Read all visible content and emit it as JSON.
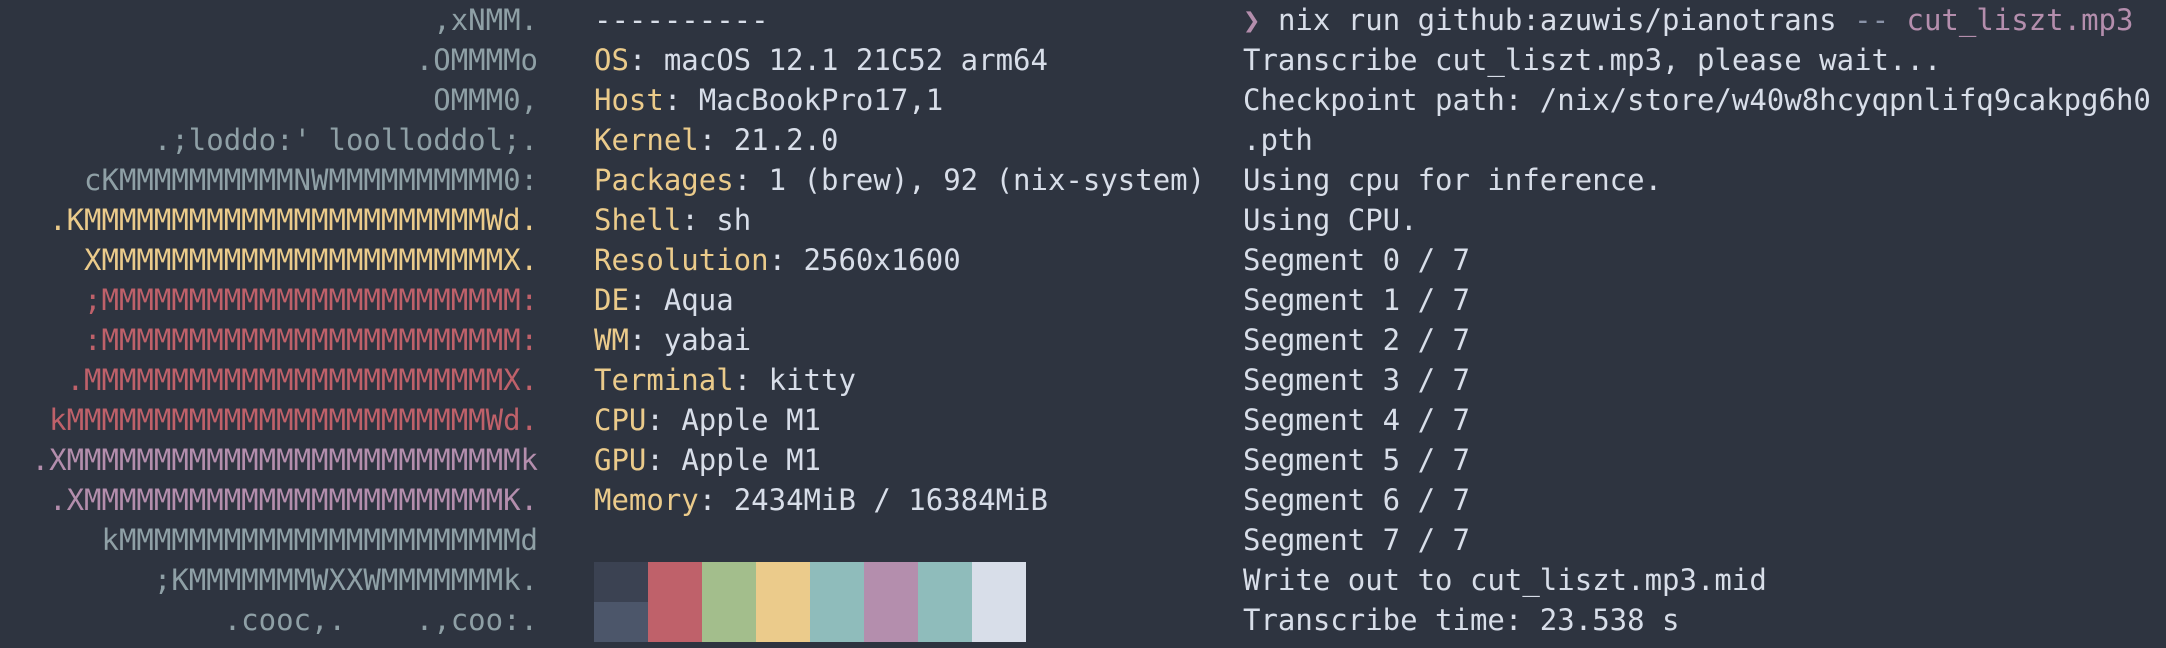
{
  "logo": {
    "lines": [
      {
        "text": ",xNMM.",
        "color": "#8fa0a6"
      },
      {
        "text": ".OMMMMo",
        "color": "#8fa0a6"
      },
      {
        "text": "OMMM0,",
        "color": "#8fa0a6"
      },
      {
        "text": ".;loddo:' loolloddol;.",
        "color": "#8fa0a6"
      },
      {
        "text": "cKMMMMMMMMMMNWMMMMMMMMMM0:",
        "color": "#8fa0a6"
      },
      {
        "text": ".KMMMMMMMMMMMMMMMMMMMMMMMWd.",
        "color": "#ebcb8b"
      },
      {
        "text": "XMMMMMMMMMMMMMMMMMMMMMMMX.",
        "color": "#ebcb8b"
      },
      {
        "text": ";MMMMMMMMMMMMMMMMMMMMMMMM:",
        "color": "#bf616a"
      },
      {
        "text": ":MMMMMMMMMMMMMMMMMMMMMMMM:",
        "color": "#bf616a"
      },
      {
        "text": ".MMMMMMMMMMMMMMMMMMMMMMMMX.",
        "color": "#bf616a"
      },
      {
        "text": "kMMMMMMMMMMMMMMMMMMMMMMMMWd.",
        "color": "#bf616a"
      },
      {
        "text": ".XMMMMMMMMMMMMMMMMMMMMMMMMMMk",
        "color": "#b48ead"
      },
      {
        "text": ".XMMMMMMMMMMMMMMMMMMMMMMMMK.",
        "color": "#b48ead"
      },
      {
        "text": "kMMMMMMMMMMMMMMMMMMMMMMMd",
        "color": "#8fa0a6"
      },
      {
        "text": ";KMMMMMMMWXXWMMMMMMMk.",
        "color": "#8fa0a6"
      },
      {
        "text": ".cooc,.    .,coo:.",
        "color": "#8fa0a6"
      }
    ]
  },
  "info": {
    "separator": "----------",
    "fields": [
      {
        "key": "OS",
        "value": "macOS 12.1 21C52 arm64"
      },
      {
        "key": "Host",
        "value": "MacBookPro17,1"
      },
      {
        "key": "Kernel",
        "value": "21.2.0"
      },
      {
        "key": "Packages",
        "value": "1 (brew), 92 (nix-system)"
      },
      {
        "key": "Shell",
        "value": "sh"
      },
      {
        "key": "Resolution",
        "value": "2560x1600"
      },
      {
        "key": "DE",
        "value": "Aqua"
      },
      {
        "key": "WM",
        "value": "yabai"
      },
      {
        "key": "Terminal",
        "value": "kitty"
      },
      {
        "key": "CPU",
        "value": "Apple M1"
      },
      {
        "key": "GPU",
        "value": "Apple M1"
      },
      {
        "key": "Memory",
        "value": "2434MiB / 16384MiB"
      }
    ],
    "palette": [
      {
        "top": "#3b4252",
        "bottom": "#4c566a"
      },
      {
        "top": "#bf616a",
        "bottom": "#bf616a"
      },
      {
        "top": "#a3be8c",
        "bottom": "#a3be8c"
      },
      {
        "top": "#ebcb8b",
        "bottom": "#ebcb8b"
      },
      {
        "top": "#8fbcbb",
        "bottom": "#8fbcbb"
      },
      {
        "top": "#b48ead",
        "bottom": "#b48ead"
      },
      {
        "top": "#8fbcbb",
        "bottom": "#8fbcbb"
      },
      {
        "top": "#d8dee9",
        "bottom": "#d8dee9"
      }
    ]
  },
  "terminal": {
    "prompt_symbol": "❯",
    "command_program": "nix run github:azuwis/pianotrans ",
    "command_flag": "--",
    "command_arg": " cut_liszt.mp3",
    "output_lines": [
      "Transcribe cut_liszt.mp3, please wait...",
      "Checkpoint path: /nix/store/w40w8hcyqpnlifq9cakpg6h0",
      ".pth",
      "Using cpu for inference.",
      "Using CPU.",
      "Segment 0 / 7",
      "Segment 1 / 7",
      "Segment 2 / 7",
      "Segment 3 / 7",
      "Segment 4 / 7",
      "Segment 5 / 7",
      "Segment 6 / 7",
      "Segment 7 / 7",
      "Write out to cut_liszt.mp3.mid",
      "Transcribe time: 23.538 s"
    ]
  }
}
